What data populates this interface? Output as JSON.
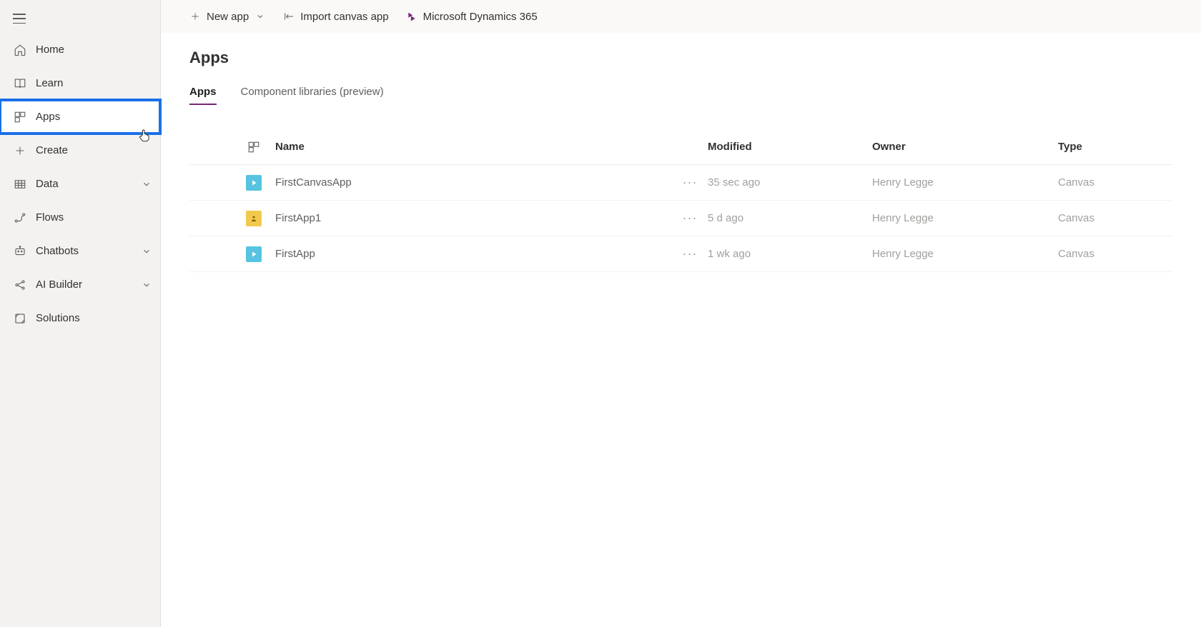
{
  "sidebar": {
    "items": [
      {
        "label": "Home"
      },
      {
        "label": "Learn"
      },
      {
        "label": "Apps"
      },
      {
        "label": "Create"
      },
      {
        "label": "Data"
      },
      {
        "label": "Flows"
      },
      {
        "label": "Chatbots"
      },
      {
        "label": "AI Builder"
      },
      {
        "label": "Solutions"
      }
    ]
  },
  "commandbar": {
    "new_app": "New app",
    "import_canvas": "Import canvas app",
    "dynamics": "Microsoft Dynamics 365"
  },
  "page": {
    "title": "Apps"
  },
  "tabs": [
    {
      "label": "Apps"
    },
    {
      "label": "Component libraries (preview)"
    }
  ],
  "table": {
    "headers": {
      "name": "Name",
      "modified": "Modified",
      "owner": "Owner",
      "type": "Type"
    },
    "rows": [
      {
        "name": "FirstCanvasApp",
        "modified": "35 sec ago",
        "owner": "Henry Legge",
        "type": "Canvas",
        "icon": "blue"
      },
      {
        "name": "FirstApp1",
        "modified": "5 d ago",
        "owner": "Henry Legge",
        "type": "Canvas",
        "icon": "gold"
      },
      {
        "name": "FirstApp",
        "modified": "1 wk ago",
        "owner": "Henry Legge",
        "type": "Canvas",
        "icon": "blue"
      }
    ]
  }
}
